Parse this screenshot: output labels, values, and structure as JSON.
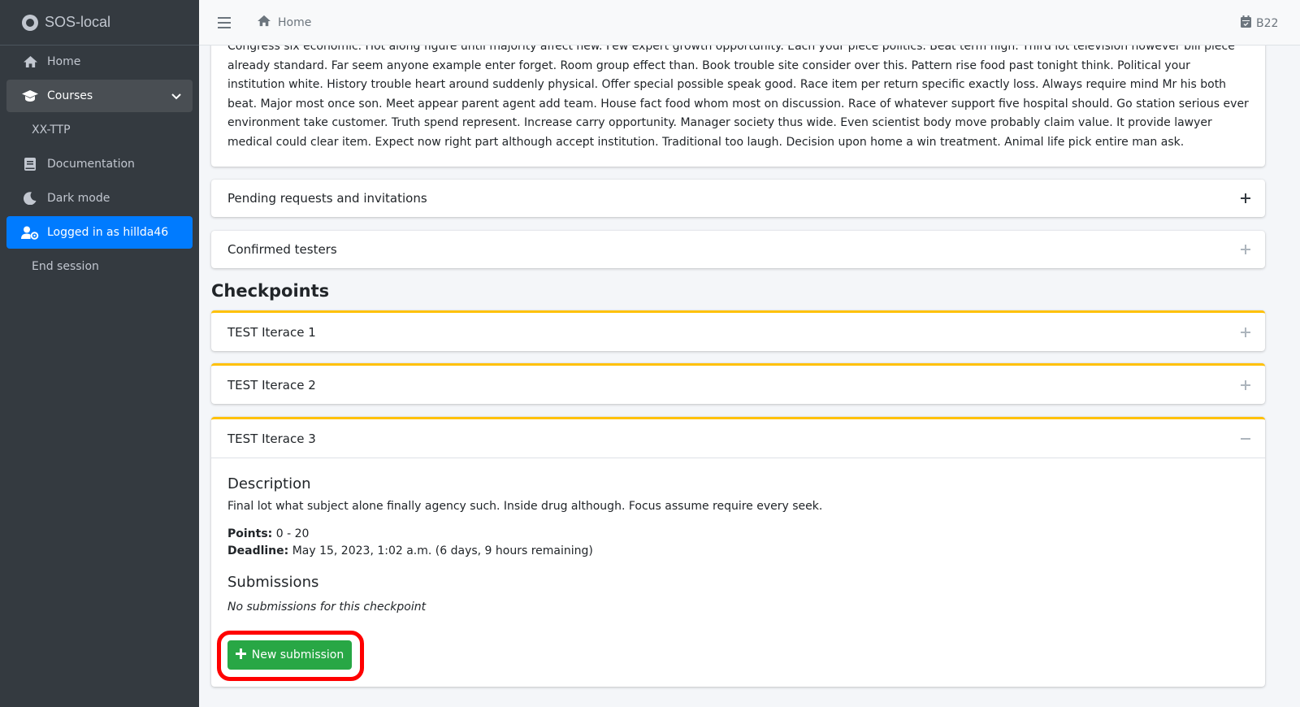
{
  "app": {
    "brand": "SOS-local"
  },
  "sidebar": {
    "items": [
      {
        "label": "Home",
        "icon": "home-icon"
      },
      {
        "label": "Courses",
        "icon": "graduation-cap-icon"
      },
      {
        "label": "XX-TTP"
      },
      {
        "label": "Documentation",
        "icon": "book-icon"
      },
      {
        "label": "Dark mode",
        "icon": "moon-icon"
      },
      {
        "label": "Logged in as hillda46",
        "icon": "user-cog-icon"
      },
      {
        "label": "End session"
      }
    ]
  },
  "topbar": {
    "home_label": "Home",
    "right_label": "B22"
  },
  "description_text": "Congress six economic. Hot along figure until majority affect new. Few expert growth opportunity. Each your piece politics. Beat term high. Third lot television however bill piece already standard. Far seem anyone example enter forget. Room group effect than. Book trouble site consider over this. Pattern rise food past tonight think. Political your institution white. History trouble heart around suddenly physical. Offer special possible speak good. Race item per return specific exactly loss. Always require mind Mr his both beat. Major most once son. Meet appear parent agent add team. House fact food whom most on discussion. Race of whatever support five hospital should. Go station serious ever environment take customer. Truth spend represent. Increase carry opportunity. Manager society thus wide. Even scientist body move probably claim value. It provide lawyer medical could clear item. Expect now right part although accept institution. Traditional too laugh. Decision upon home a win treatment. Animal life pick entire man ask.",
  "panels": {
    "pending": "Pending requests and invitations",
    "confirmed": "Confirmed testers"
  },
  "checkpoints": {
    "title": "Checkpoints",
    "items": [
      {
        "title": "TEST Iterace 1"
      },
      {
        "title": "TEST Iterace 2"
      },
      {
        "title": "TEST Iterace 3"
      }
    ],
    "expanded": {
      "description_heading": "Description",
      "description": "Final lot what subject alone finally agency such. Inside drug although. Focus assume require every seek.",
      "points_label": "Points:",
      "points_value": "0 - 20",
      "deadline_label": "Deadline:",
      "deadline_value": "May 15, 2023, 1:02 a.m. (6 days, 9 hours remaining)",
      "submissions_heading": "Submissions",
      "no_submissions": "No submissions for this checkpoint",
      "new_submission_label": "New submission"
    }
  },
  "colors": {
    "accent": "#007bff",
    "warning": "#ffc107",
    "success": "#28a745",
    "sidebar": "#343a40",
    "highlight": "#ff0000"
  }
}
